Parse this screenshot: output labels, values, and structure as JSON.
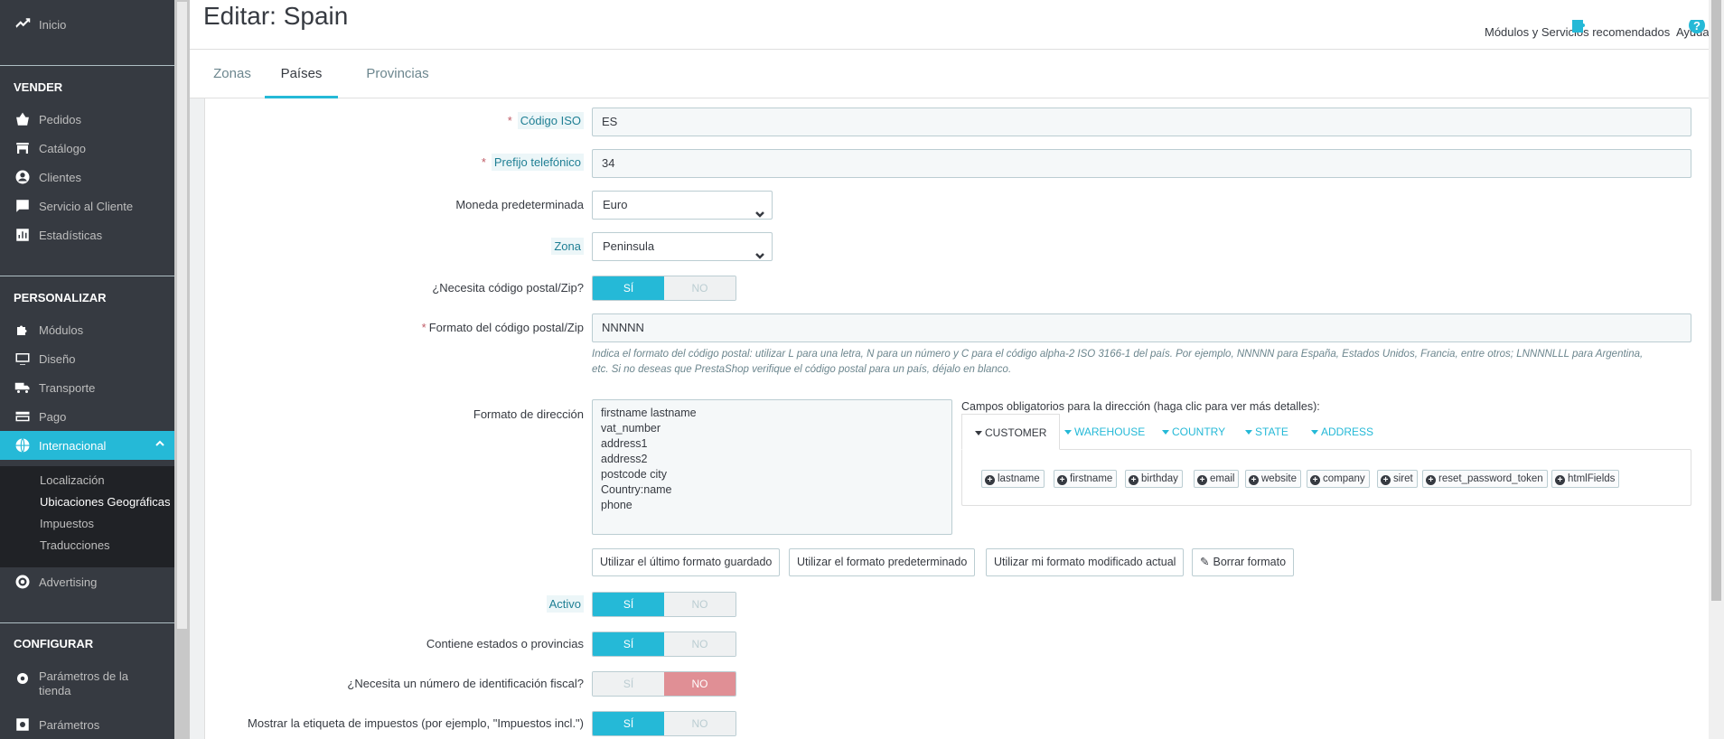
{
  "sidebar": {
    "top_item": "Inicio",
    "sections": [
      "VENDER",
      "PERSONALIZAR",
      "CONFIGURAR"
    ],
    "sell_items": [
      "Pedidos",
      "Catálogo",
      "Clientes",
      "Servicio al Cliente",
      "Estadísticas"
    ],
    "custom_items": [
      "Módulos",
      "Diseño",
      "Transporte",
      "Pago",
      "Internacional"
    ],
    "submenu": [
      "Localización",
      "Ubicaciones Geográficas",
      "Impuestos",
      "Traducciones"
    ],
    "advertising": "Advertising",
    "config_items": [
      "Parámetros de la tienda",
      "Parámetros"
    ]
  },
  "header": {
    "title": "Editar: Spain",
    "modules_label": "Módulos y Servicios recomendados",
    "help_label": "Ayuda"
  },
  "tabs": [
    "Zonas",
    "Países",
    "Provincias"
  ],
  "form": {
    "iso_label": "Código ISO",
    "iso_value": "ES",
    "phone_label": "Prefijo telefónico",
    "phone_value": "34",
    "currency_label": "Moneda predeterminada",
    "currency_value": "Euro",
    "zone_label": "Zona",
    "zone_value": "Peninsula",
    "zip_needed_label": "¿Necesita código postal/Zip?",
    "zip_format_label": "Formato del código postal/Zip",
    "zip_format_value": "NNNNN",
    "zip_help_line1": "Indica el formato del código postal: utilizar L para una letra, N para un número y C para el código alpha-2 ISO 3166-1 del país. Por ejemplo, NNNNN para España, Estados Unidos, Francia, entre otros; LNNNNLLL para Argentina,",
    "zip_help_line2": "etc. Si no deseas que PrestaShop verifique el código postal para un país, déjalo en blanco.",
    "address_label": "Formato de dirección",
    "address_lines": [
      "firstname lastname",
      "vat_number",
      "address1",
      "address2",
      "postcode city",
      "Country:name",
      "phone"
    ],
    "fields_title": "Campos obligatorios para la dirección (haga clic para ver más detalles):",
    "field_tabs": [
      "CUSTOMER",
      "WAREHOUSE",
      "COUNTRY",
      "STATE",
      "ADDRESS"
    ],
    "customer_fields": [
      "lastname",
      "firstname",
      "birthday",
      "email",
      "website",
      "company",
      "siret",
      "reset_password_token",
      "htmlFields"
    ],
    "format_buttons": [
      "Utilizar el último formato guardado",
      "Utilizar el formato predeterminado",
      "Utilizar mi formato modificado actual",
      "Borrar formato"
    ],
    "active_label": "Activo",
    "states_label": "Contiene estados o provincias",
    "tax_id_label": "¿Necesita un número de identificación fiscal?",
    "tax_label_label": "Mostrar la etiqueta de impuestos (por ejemplo, \"Impuestos incl.\")",
    "yes": "SÍ",
    "no": "NO"
  },
  "colors": {
    "accent": "#25b9d7",
    "sidebar": "#363a41",
    "danger": "#e08f95"
  }
}
